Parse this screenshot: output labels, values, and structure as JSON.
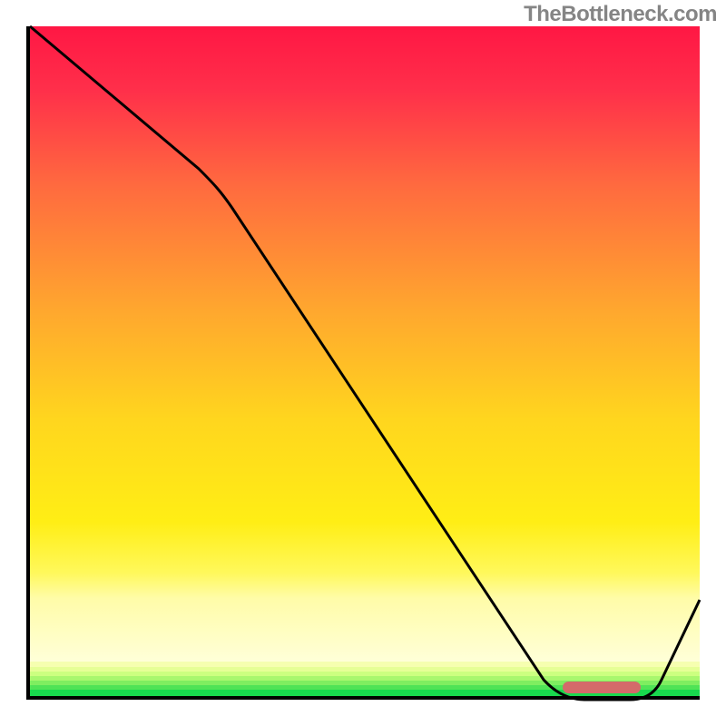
{
  "attribution": "TheBottleneck.com",
  "colors": {
    "gradient_top": "#ff1744",
    "gradient_mid": "#ffd61e",
    "gradient_bottom": "#18d94e",
    "curve": "#000000",
    "marker": "#d46a6a",
    "axis": "#000000"
  },
  "chart_data": {
    "type": "line",
    "title": "",
    "xlabel": "",
    "ylabel": "",
    "xlim": [
      0,
      100
    ],
    "ylim": [
      0,
      100
    ],
    "grid": false,
    "legend": false,
    "series": [
      {
        "name": "bottleneck-curve",
        "x": [
          0,
          26,
          31,
          77,
          83,
          90,
          94,
          100
        ],
        "y": [
          100,
          79,
          72,
          3,
          0,
          0,
          3,
          15
        ]
      }
    ],
    "annotations": [
      {
        "name": "optimal-range-marker",
        "shape": "rounded-bar",
        "x_start": 80,
        "x_end": 91,
        "y": 2,
        "color": "#d46a6a"
      }
    ],
    "background": {
      "kind": "vertical-gradient",
      "stops": [
        {
          "pos": 0.0,
          "color": "#ff1744"
        },
        {
          "pos": 0.45,
          "color": "#ffa82e"
        },
        {
          "pos": 0.78,
          "color": "#ffee15"
        },
        {
          "pos": 0.92,
          "color": "#ffffd8"
        },
        {
          "pos": 1.0,
          "color": "#18d94e"
        }
      ]
    }
  }
}
